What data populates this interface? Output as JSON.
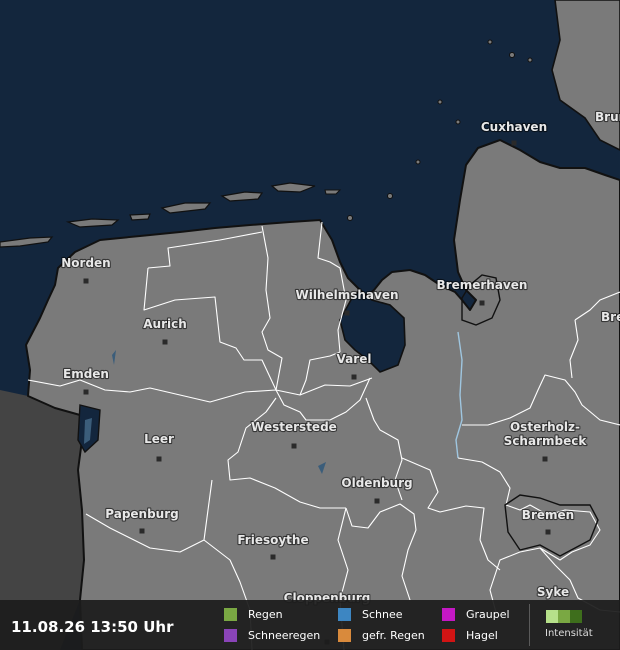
{
  "map": {
    "cities": [
      {
        "name": "Cuxhaven"
      },
      {
        "name": "Brun"
      },
      {
        "name": "Norden"
      },
      {
        "name": "Wilhelmshaven"
      },
      {
        "name": "Bremerhaven"
      },
      {
        "name": "Bre"
      },
      {
        "name": "Aurich"
      },
      {
        "name": "Varel"
      },
      {
        "name": "Emden"
      },
      {
        "name": "Leer"
      },
      {
        "name": "Westerstede"
      },
      {
        "name": "Osterholz-"
      },
      {
        "name": "Scharmbeck"
      },
      {
        "name": "Oldenburg"
      },
      {
        "name": "Bremen"
      },
      {
        "name": "Papenburg"
      },
      {
        "name": "Friesoythe"
      },
      {
        "name": "Syke"
      },
      {
        "name": "Cloppenburg"
      }
    ],
    "colors": {
      "sea": "#13263d",
      "land": "#7a7a7a",
      "foreign_land": "#444444",
      "borders": "#ffffff"
    }
  },
  "bottom_bar": {
    "timestamp": "11.08.26 13:50 Uhr",
    "legend": [
      {
        "label": "Regen",
        "color": "#7aa843"
      },
      {
        "label": "Schnee",
        "color": "#3d86c2"
      },
      {
        "label": "Graupel",
        "color": "#c418c4"
      },
      {
        "label": "Schneeregen",
        "color": "#8a44b8"
      },
      {
        "label": "gefr. Regen",
        "color": "#d98a3c"
      },
      {
        "label": "Hagel",
        "color": "#d11414"
      }
    ],
    "intensity": {
      "label": "Intensität",
      "colors": [
        "#b6e08a",
        "#7aa843",
        "#3e6e1c"
      ]
    }
  }
}
